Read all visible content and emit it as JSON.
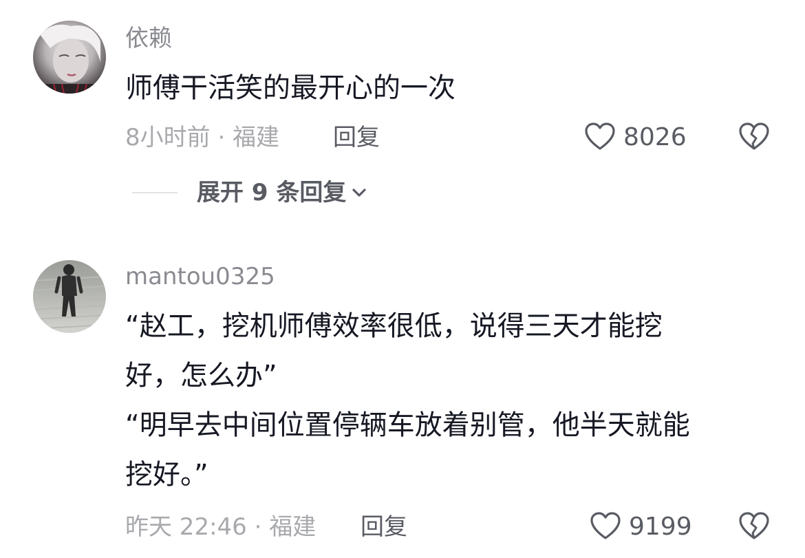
{
  "comments": [
    {
      "username": "依赖",
      "lines": [
        "师傅干活笑的最开心的一次"
      ],
      "meta": "8小时前 · 福建",
      "reply_label": "回复",
      "likes": "8026",
      "expand_label": "展开 9 条回复"
    },
    {
      "username": "mantou0325",
      "lines": [
        "“赵工，挖机师傅效率很低，说得三天才能挖",
        "好，怎么办”",
        "“明早去中间位置停辆车放着别管，他半天就能",
        "挖好。”"
      ],
      "meta": "昨天 22:46 · 福建",
      "reply_label": "回复",
      "likes": "9199"
    }
  ],
  "icons": {
    "like": "heart-outline-icon",
    "dislike": "broken-heart-icon",
    "expand": "chevron-down-icon"
  },
  "colors": {
    "primary_text": "#161823",
    "secondary_text": "#8a8b91",
    "meta_text": "#a8a9ad",
    "action_text": "#595b63"
  }
}
